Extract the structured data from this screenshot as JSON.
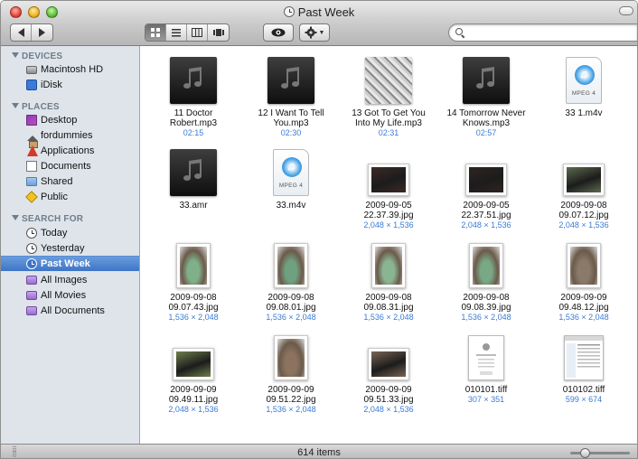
{
  "window": {
    "title": "Past Week"
  },
  "toolbar": {
    "back_icon": "back-arrow-icon",
    "forward_icon": "forward-arrow-icon",
    "view_modes": [
      "icon-view",
      "list-view",
      "column-view",
      "coverflow-view"
    ],
    "active_view": "icon-view",
    "quicklook_icon": "eye-icon",
    "action_icon": "gear-icon",
    "search": {
      "value": "",
      "placeholder": ""
    }
  },
  "sidebar": {
    "sections": [
      {
        "title": "DEVICES",
        "items": [
          {
            "label": "Macintosh HD",
            "icon": "hard-drive-icon"
          },
          {
            "label": "iDisk",
            "icon": "idisk-icon"
          }
        ]
      },
      {
        "title": "PLACES",
        "items": [
          {
            "label": "Desktop",
            "icon": "desktop-icon"
          },
          {
            "label": "fordummies",
            "icon": "home-icon"
          },
          {
            "label": "Applications",
            "icon": "applications-icon"
          },
          {
            "label": "Documents",
            "icon": "documents-icon"
          },
          {
            "label": "Shared",
            "icon": "folder-icon"
          },
          {
            "label": "Public",
            "icon": "public-icon"
          }
        ]
      },
      {
        "title": "SEARCH FOR",
        "items": [
          {
            "label": "Today",
            "icon": "clock-icon"
          },
          {
            "label": "Yesterday",
            "icon": "clock-icon"
          },
          {
            "label": "Past Week",
            "icon": "clock-icon",
            "selected": true
          },
          {
            "label": "All Images",
            "icon": "smart-folder-icon"
          },
          {
            "label": "All Movies",
            "icon": "smart-folder-icon"
          },
          {
            "label": "All Documents",
            "icon": "smart-folder-icon"
          }
        ]
      }
    ]
  },
  "files": [
    {
      "name1": "11 Doctor",
      "name2": "Robert.mp3",
      "meta": "02:15",
      "kind": "music"
    },
    {
      "name1": "12 I Want To Tell",
      "name2": "You.mp3",
      "meta": "02:30",
      "kind": "music"
    },
    {
      "name1": "13 Got To Get You",
      "name2": "Into My Life.mp3",
      "meta": "02:31",
      "kind": "album"
    },
    {
      "name1": "14 Tomorrow Never",
      "name2": "Knows.mp3",
      "meta": "02:57",
      "kind": "music"
    },
    {
      "name1": "33 1.m4v",
      "name2": "",
      "meta": "",
      "kind": "m4v"
    },
    {
      "name1": "33.amr",
      "name2": "",
      "meta": "",
      "kind": "music"
    },
    {
      "name1": "33.m4v",
      "name2": "",
      "meta": "",
      "kind": "m4v"
    },
    {
      "name1": "2009-09-05",
      "name2": "22.37.39.jpg",
      "meta": "2,048 × 1,536",
      "kind": "photo-l",
      "tint": "#3b2a26"
    },
    {
      "name1": "2009-09-05",
      "name2": "22.37.51.jpg",
      "meta": "2,048 × 1,536",
      "kind": "photo-l",
      "tint": "#2f2422"
    },
    {
      "name1": "2009-09-08",
      "name2": "09.07.12.jpg",
      "meta": "2,048 × 1,536",
      "kind": "photo-l",
      "tint": "#5d6b4f"
    },
    {
      "name1": "2009-09-08",
      "name2": "09.07.43.jpg",
      "meta": "1,536 × 2,048",
      "kind": "photo-p",
      "tint": "#7fb08a"
    },
    {
      "name1": "2009-09-08",
      "name2": "09.08.01.jpg",
      "meta": "1,536 × 2,048",
      "kind": "photo-p",
      "tint": "#6fa080"
    },
    {
      "name1": "2009-09-08",
      "name2": "09.08.31.jpg",
      "meta": "1,536 × 2,048",
      "kind": "photo-p",
      "tint": "#8ab593"
    },
    {
      "name1": "2009-09-08",
      "name2": "09.08.39.jpg",
      "meta": "1,536 × 2,048",
      "kind": "photo-p",
      "tint": "#79a886"
    },
    {
      "name1": "2009-09-09",
      "name2": "09.48.12.jpg",
      "meta": "1,536 × 2,048",
      "kind": "photo-p",
      "tint": "#8a7a6a"
    },
    {
      "name1": "2009-09-09",
      "name2": "09.49.11.jpg",
      "meta": "2,048 × 1,536",
      "kind": "photo-l",
      "tint": "#6e7f4c"
    },
    {
      "name1": "2009-09-09",
      "name2": "09.51.22.jpg",
      "meta": "1,536 × 2,048",
      "kind": "photo-p",
      "tint": "#8c7360"
    },
    {
      "name1": "2009-09-09",
      "name2": "09.51.33.jpg",
      "meta": "2,048 × 1,536",
      "kind": "photo-l",
      "tint": "#7a6555"
    },
    {
      "name1": "010101.tiff",
      "name2": "",
      "meta": "307 × 351",
      "kind": "doc"
    },
    {
      "name1": "010102.tiff",
      "name2": "",
      "meta": "599 × 674",
      "kind": "doc2"
    }
  ],
  "m4v_label": "MPEG 4",
  "status": {
    "count": "614 items"
  },
  "colors": {
    "sidebar_bg": "#dee4ea",
    "selection": "#3e74c6",
    "meta_text": "#3a7bd5"
  }
}
